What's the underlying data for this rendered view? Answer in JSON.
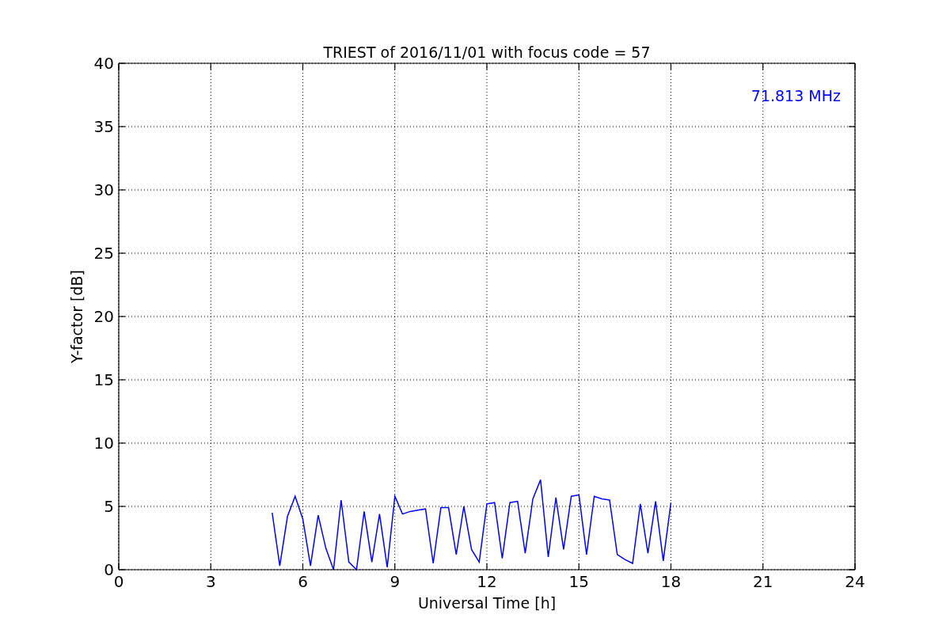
{
  "figure": {
    "chart_data": {
      "type": "line",
      "title": "TRIEST of 2016/11/01 with focus code = 57",
      "xlabel": "Universal Time [h]",
      "ylabel": "Y-factor [dB]",
      "x": [
        5,
        5.25,
        5.5,
        5.75,
        6,
        6.25,
        6.5,
        6.75,
        7,
        7.25,
        7.5,
        7.75,
        8,
        8.25,
        8.5,
        8.75,
        9,
        9.25,
        9.5,
        9.75,
        10,
        10.25,
        10.5,
        10.75,
        11,
        11.25,
        11.5,
        11.75,
        12,
        12.25,
        12.5,
        12.75,
        13,
        13.25,
        13.5,
        13.75,
        14,
        14.25,
        14.5,
        14.75,
        15,
        15.25,
        15.5,
        15.75,
        16,
        16.25,
        16.5,
        16.75,
        17,
        17.25,
        17.5,
        17.75,
        18
      ],
      "series": [
        {
          "name": "71.813 MHz",
          "color": "#0000ff",
          "values": [
            4.5,
            0.3,
            4.2,
            5.8,
            4.0,
            0.3,
            4.3,
            1.7,
            0.0,
            5.5,
            0.6,
            0.0,
            4.6,
            0.6,
            4.4,
            0.2,
            5.8,
            4.4,
            4.6,
            4.7,
            4.8,
            0.5,
            4.9,
            4.9,
            1.2,
            5.0,
            1.6,
            0.6,
            5.2,
            5.3,
            0.9,
            5.3,
            5.4,
            1.3,
            5.6,
            7.1,
            1.0,
            5.7,
            1.6,
            5.8,
            5.9,
            1.2,
            5.8,
            5.6,
            5.5,
            1.2,
            0.8,
            0.5,
            5.2,
            1.3,
            5.4,
            0.7,
            5.3
          ]
        }
      ],
      "xlim": [
        0,
        24
      ],
      "ylim": [
        0,
        40
      ],
      "xticks": [
        0,
        3,
        6,
        9,
        12,
        15,
        18,
        21,
        24
      ],
      "yticks": [
        0,
        5,
        10,
        15,
        20,
        25,
        30,
        35,
        40
      ],
      "grid": true
    }
  }
}
